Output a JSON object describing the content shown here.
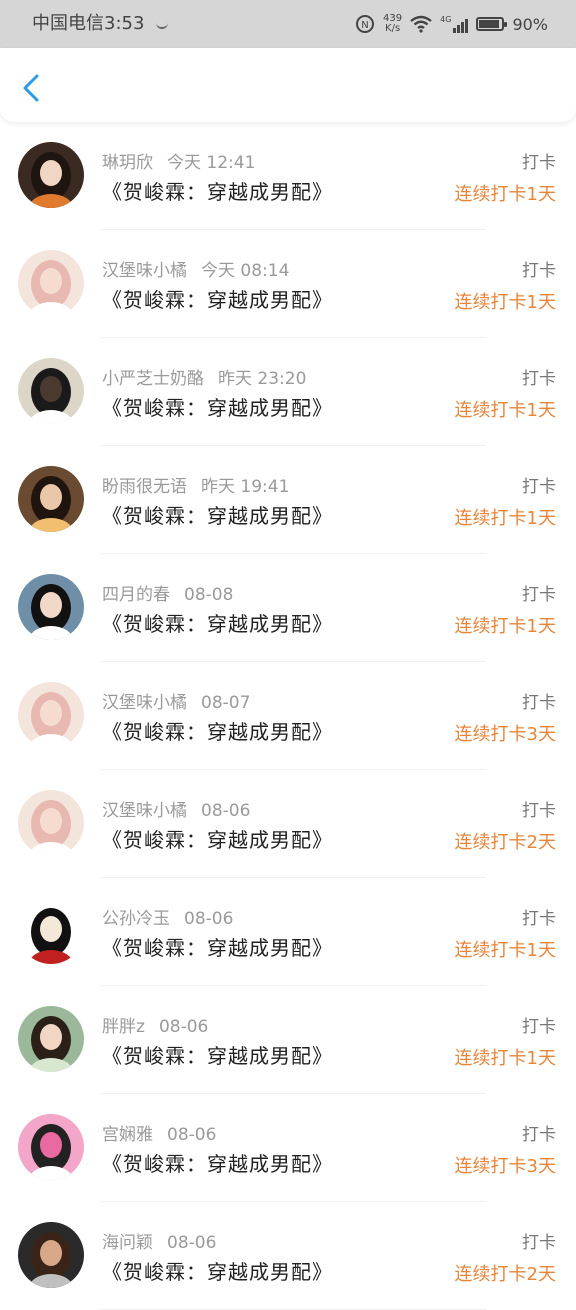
{
  "status_bar": {
    "carrier_time": "中国电信3:53",
    "speed_value": "439",
    "speed_unit": "K/s",
    "network": "4G",
    "battery_text": "90%",
    "battery_level": 0.9
  },
  "header": {
    "back_icon": "chevron-left-icon",
    "accent_color": "#2a9be6"
  },
  "checkins": [
    {
      "name": "琳玥欣",
      "time": "今天 12:41",
      "book": "《贺峻霖：穿越成男配》",
      "action": "打卡",
      "streak": "连续打卡1天"
    },
    {
      "name": "汉堡味小橘",
      "time": "今天 08:14",
      "book": "《贺峻霖：穿越成男配》",
      "action": "打卡",
      "streak": "连续打卡1天"
    },
    {
      "name": "小严芝士奶酪",
      "time": "昨天 23:20",
      "book": "《贺峻霖：穿越成男配》",
      "action": "打卡",
      "streak": "连续打卡1天"
    },
    {
      "name": "盼雨很无语",
      "time": "昨天 19:41",
      "book": "《贺峻霖：穿越成男配》",
      "action": "打卡",
      "streak": "连续打卡1天"
    },
    {
      "name": "四月的春",
      "time": "08-08",
      "book": "《贺峻霖：穿越成男配》",
      "action": "打卡",
      "streak": "连续打卡1天"
    },
    {
      "name": "汉堡味小橘",
      "time": "08-07",
      "book": "《贺峻霖：穿越成男配》",
      "action": "打卡",
      "streak": "连续打卡3天"
    },
    {
      "name": "汉堡味小橘",
      "time": "08-06",
      "book": "《贺峻霖：穿越成男配》",
      "action": "打卡",
      "streak": "连续打卡2天"
    },
    {
      "name": "公孙冷玉",
      "time": "08-06",
      "book": "《贺峻霖：穿越成男配》",
      "action": "打卡",
      "streak": "连续打卡1天"
    },
    {
      "name": "胖胖z",
      "time": "08-06",
      "book": "《贺峻霖：穿越成男配》",
      "action": "打卡",
      "streak": "连续打卡1天"
    },
    {
      "name": "宫娴雅",
      "time": "08-06",
      "book": "《贺峻霖：穿越成男配》",
      "action": "打卡",
      "streak": "连续打卡3天"
    },
    {
      "name": "海问颖",
      "time": "08-06",
      "book": "《贺峻霖：穿越成男配》",
      "action": "打卡",
      "streak": "连续打卡2天"
    }
  ],
  "avatar_styles": [
    {
      "bg": "#3a2a22",
      "face": "#f1d6c4",
      "hair": "#1e1410",
      "accent": "#e07a2e"
    },
    {
      "bg": "#f3e4dc",
      "face": "#f6dccf",
      "hair": "#e8b9b0",
      "accent": "#ffffff"
    },
    {
      "bg": "#dcd6c8",
      "face": "#4a3a30",
      "hair": "#1a1a1a",
      "accent": "#ffffff"
    },
    {
      "bg": "#6a4a30",
      "face": "#e8c8a8",
      "hair": "#20140e",
      "accent": "#f0c070"
    },
    {
      "bg": "#6f8fa8",
      "face": "#f1d8c8",
      "hair": "#111111",
      "accent": "#ffffff"
    },
    {
      "bg": "#f3e4dc",
      "face": "#f6dccf",
      "hair": "#e8b9b0",
      "accent": "#ffffff"
    },
    {
      "bg": "#f3e4dc",
      "face": "#f6dccf",
      "hair": "#e8b9b0",
      "accent": "#ffffff"
    },
    {
      "bg": "#ffffff",
      "face": "#f4e8d8",
      "hair": "#111111",
      "accent": "#c02020"
    },
    {
      "bg": "#9bb89a",
      "face": "#f1d6c4",
      "hair": "#2a2018",
      "accent": "#d8e8d0"
    },
    {
      "bg": "#f4a6c8",
      "face": "#e86aa0",
      "hair": "#222222",
      "accent": "#ffffff"
    },
    {
      "bg": "#2a2a2a",
      "face": "#d8a888",
      "hair": "#3a2418",
      "accent": "#c0c0c0"
    }
  ]
}
